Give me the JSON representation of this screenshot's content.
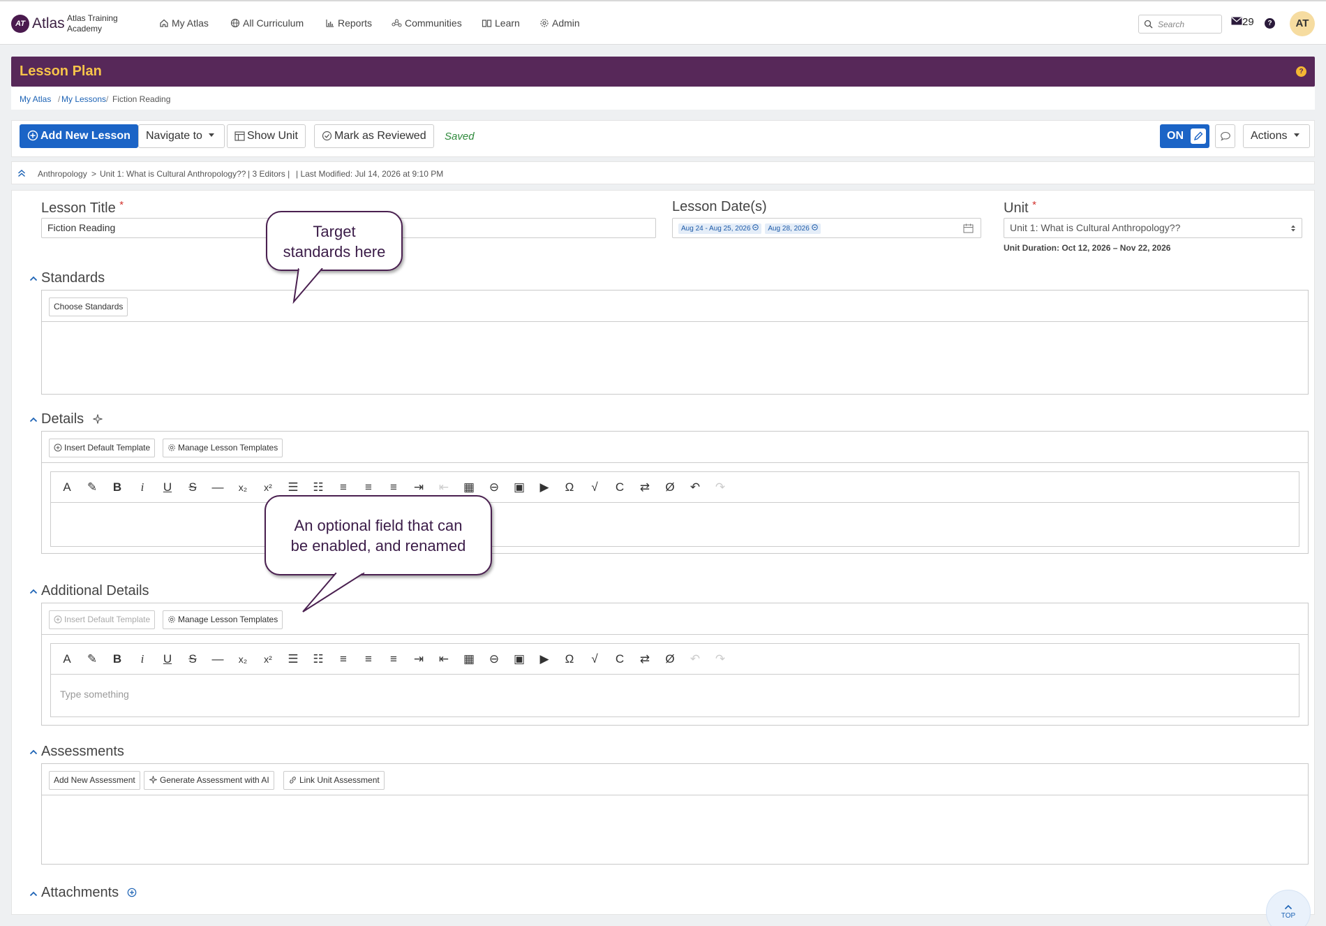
{
  "app": {
    "logo_text": "Atlas",
    "logo_mark": "AT",
    "school": "Atlas Training Academy"
  },
  "nav": [
    {
      "label": "My Atlas",
      "icon": "house-icon"
    },
    {
      "label": "All Curriculum",
      "icon": "globe-icon"
    },
    {
      "label": "Reports",
      "icon": "bar-chart-icon"
    },
    {
      "label": "Communities",
      "icon": "network-icon"
    },
    {
      "label": "Learn",
      "icon": "book-icon"
    },
    {
      "label": "Admin",
      "icon": "gear-icon"
    }
  ],
  "header": {
    "search_placeholder": "Search",
    "mail_count": "29",
    "help": "?",
    "avatar": "AT"
  },
  "banner": {
    "title": "Lesson Plan",
    "help": "?",
    "color": "#572859",
    "title_color": "#f7c44a"
  },
  "breadcrumb": {
    "items": [
      "My Atlas",
      "My Lessons"
    ],
    "current": "Fiction Reading",
    "sep": "/"
  },
  "toolbar": {
    "add_new_lesson": "Add New Lesson",
    "navigate_to": "Navigate to",
    "show_unit": "Show Unit",
    "mark_reviewed": "Mark as Reviewed",
    "saved": "Saved",
    "on": "ON",
    "actions": "Actions",
    "accent": "#1b64c6"
  },
  "meta": {
    "course": "Anthropology",
    "sep": ">",
    "unit": "Unit 1: What is Cultural Anthropology??",
    "editors": "| 3 Editors |",
    "modified": "| Last Modified: Jul 14, 2026 at 9:10 PM"
  },
  "fields": {
    "lesson_title_label": "Lesson Title",
    "required_mark": "*",
    "lesson_title_value": "Fiction Reading",
    "dates_label": "Lesson Date(s)",
    "date_chips": [
      "Aug 24 - Aug 25, 2026",
      "Aug 28, 2026"
    ],
    "unit_label": "Unit",
    "unit_value": "Unit 1: What is Cultural Anthropology??",
    "unit_duration": "Unit Duration: Oct 12, 2026 – Nov 22, 2026"
  },
  "sections": {
    "standards": {
      "label": "Standards",
      "button": "Choose Standards"
    },
    "details": {
      "label": "Details",
      "insert_template": "Insert Default Template",
      "manage_templates": "Manage Lesson Templates"
    },
    "additional": {
      "label": "Additional Details",
      "insert_template": "Insert Default Template",
      "manage_templates": "Manage Lesson Templates",
      "placeholder": "Type something"
    },
    "assessments": {
      "label": "Assessments",
      "add": "Add New Assessment",
      "generate": "Generate Assessment with AI",
      "link": "Link Unit Assessment"
    },
    "attachments": {
      "label": "Attachments"
    }
  },
  "editor_tools": [
    "text-color-icon",
    "highlight-icon",
    "bold-icon",
    "italic-icon",
    "underline-icon",
    "strikethrough-icon",
    "horizontal-rule-icon",
    "subscript-icon",
    "superscript-icon",
    "ordered-list-icon",
    "bullet-list-icon",
    "align-left-icon",
    "align-center-icon",
    "align-right-icon",
    "indent-icon",
    "outdent-icon",
    "table-icon",
    "link-icon",
    "image-icon",
    "video-icon",
    "special-char-icon",
    "math-icon",
    "citation-icon",
    "swap-icon",
    "clear-format-icon",
    "undo-icon",
    "redo-icon"
  ],
  "callouts": {
    "standards_line1": "Target",
    "standards_line2": "standards here",
    "optional_line1": "An optional field that can",
    "optional_line2": "be enabled, and renamed"
  },
  "scroll_top": "TOP"
}
